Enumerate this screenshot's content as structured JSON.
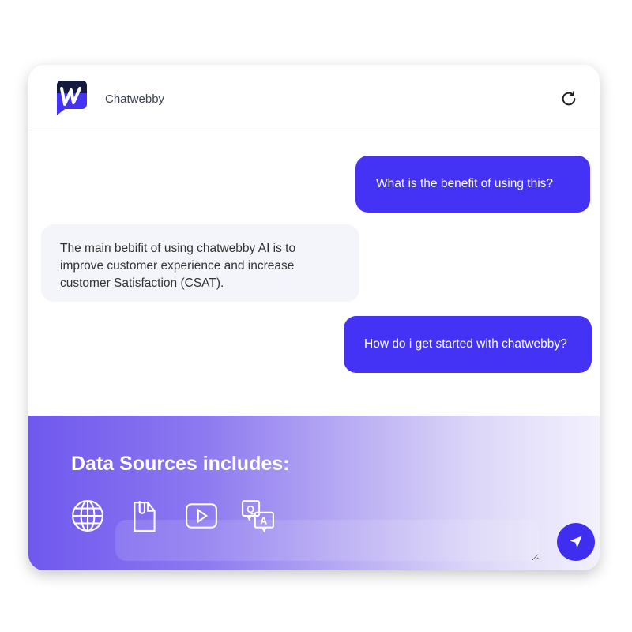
{
  "header": {
    "brand": "Chatwebby",
    "logo_icon": "chatwebby-logo",
    "refresh_icon": "refresh-icon"
  },
  "messages": [
    {
      "role": "user",
      "text": "What is the benefit of using this?"
    },
    {
      "role": "bot",
      "text": "The main bebifit of using chatwebby AI is to improve customer experience and increase customer Satisfaction (CSAT)."
    },
    {
      "role": "user",
      "text": "How do i get started with chatwebby?"
    }
  ],
  "footer": {
    "title": "Data Sources includes:",
    "sources": [
      "globe-icon",
      "document-icon",
      "video-icon",
      "qa-icon"
    ],
    "input_value": ""
  },
  "colors": {
    "accent": "#4433f5",
    "bot_bubble": "#f3f5fb"
  }
}
